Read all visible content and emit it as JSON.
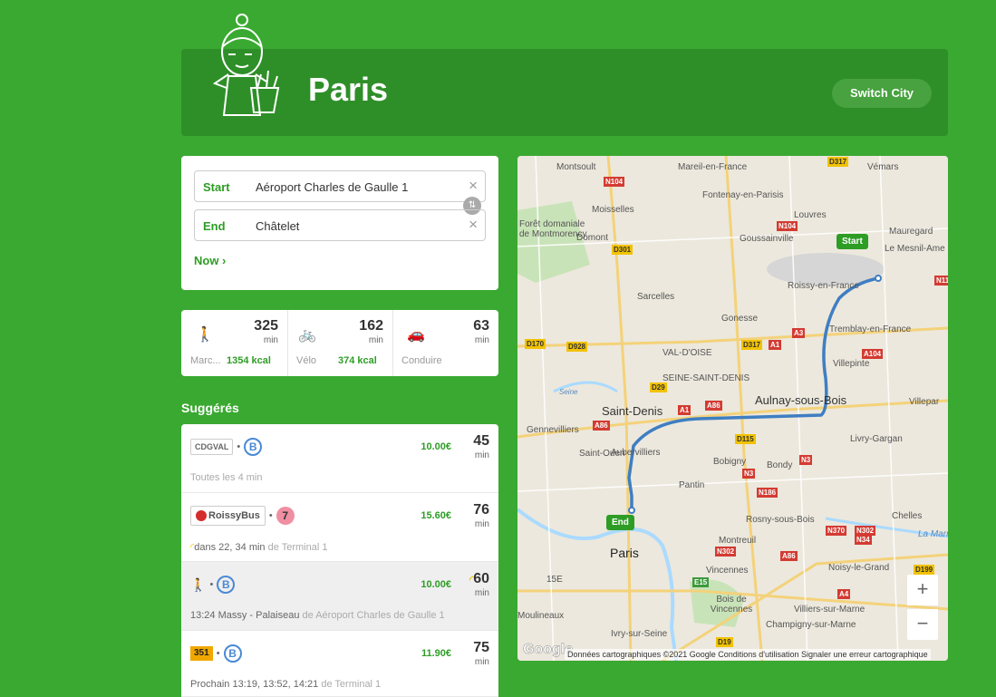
{
  "header": {
    "city": "Paris",
    "switch_label": "Switch City"
  },
  "search": {
    "start_label": "Start",
    "start_value": "Aéroport Charles de Gaulle 1",
    "end_label": "End",
    "end_value": "Châtelet",
    "clear_icon": "×",
    "swap_icon": "⇅",
    "now_label": "Now ›"
  },
  "modes": [
    {
      "icon": "walking-icon",
      "minutes": "325",
      "unit": "min",
      "label": "Marc...",
      "kcal": "1354 kcal"
    },
    {
      "icon": "bicycle-icon",
      "minutes": "162",
      "unit": "min",
      "label": "Vélo",
      "kcal": "374 kcal"
    },
    {
      "icon": "car-icon",
      "minutes": "63",
      "unit": "min",
      "label": "Conduire",
      "kcal": ""
    }
  ],
  "suggestions_title": "Suggérés",
  "routes": [
    {
      "agency": "CDGVAL",
      "line": "B",
      "price": "10.00€",
      "minutes": "45",
      "unit": "min",
      "detail": "Toutes les 4 min",
      "from": ""
    },
    {
      "agency": "RoissyBus",
      "line": "7",
      "price": "15.60€",
      "minutes": "76",
      "unit": "min",
      "detail": "dans 22, 34 min",
      "from": "de Terminal 1"
    },
    {
      "agency": "walk",
      "line": "B",
      "price": "10.00€",
      "minutes": "60",
      "unit": "min",
      "detail": "13:24 Massy - Palaiseau",
      "from": "de Aéroport Charles de Gaulle 1"
    },
    {
      "agency": "351",
      "line": "B",
      "price": "11.90€",
      "minutes": "75",
      "unit": "min",
      "detail": "Prochain 13:19, 13:52, 14:21",
      "from": "de Terminal 1"
    }
  ],
  "map": {
    "start_pin": "Start",
    "end_pin": "End",
    "labels": [
      "Montsoult",
      "Mareil-en-France",
      "Vémars",
      "Fontenay-en-Parisis",
      "Moisselles",
      "Louvres",
      "Goussainville",
      "Mauregard",
      "Le Mesnil-Ame",
      "Forêt domaniale de Montmorency",
      "Domont",
      "Roissy-en-France",
      "Sarcelles",
      "Gonesse",
      "Tremblay-en-France",
      "VAL-D'OISE",
      "Villepinte",
      "SEINE-SAINT-DENIS",
      "Aulnay-sous-Bois",
      "Villepar",
      "Saint-Denis",
      "Gennevilliers",
      "Livry-Gargan",
      "Saint-Ouen",
      "Aubervilliers",
      "Bobigny",
      "Bondy",
      "Pantin",
      "Rosny-sous-Bois",
      "Chelles",
      "Montreuil",
      "Paris",
      "Vincennes",
      "Noisy-le-Grand",
      "15E",
      "Bois de Vincennes",
      "Villiers-sur-Marne",
      "Champigny-sur-Marne",
      "Moulineaux",
      "Ivry-sur-Seine",
      "La Marne",
      "Seine"
    ],
    "roads": [
      "N104",
      "D317",
      "N104",
      "D301",
      "N11",
      "D170",
      "D928",
      "D317",
      "A1",
      "A3",
      "A104",
      "D29",
      "A86",
      "A1",
      "A86",
      "D115",
      "N3",
      "N3",
      "N186",
      "N370",
      "N302",
      "N34",
      "N302",
      "A86",
      "D199",
      "E15",
      "A4",
      "D19",
      "A4",
      "D170"
    ],
    "attribution": "Données cartographiques ©2021 Google   Conditions d'utilisation   Signaler une erreur cartographique",
    "google": "Google",
    "zoom_in": "+",
    "zoom_out": "−"
  }
}
